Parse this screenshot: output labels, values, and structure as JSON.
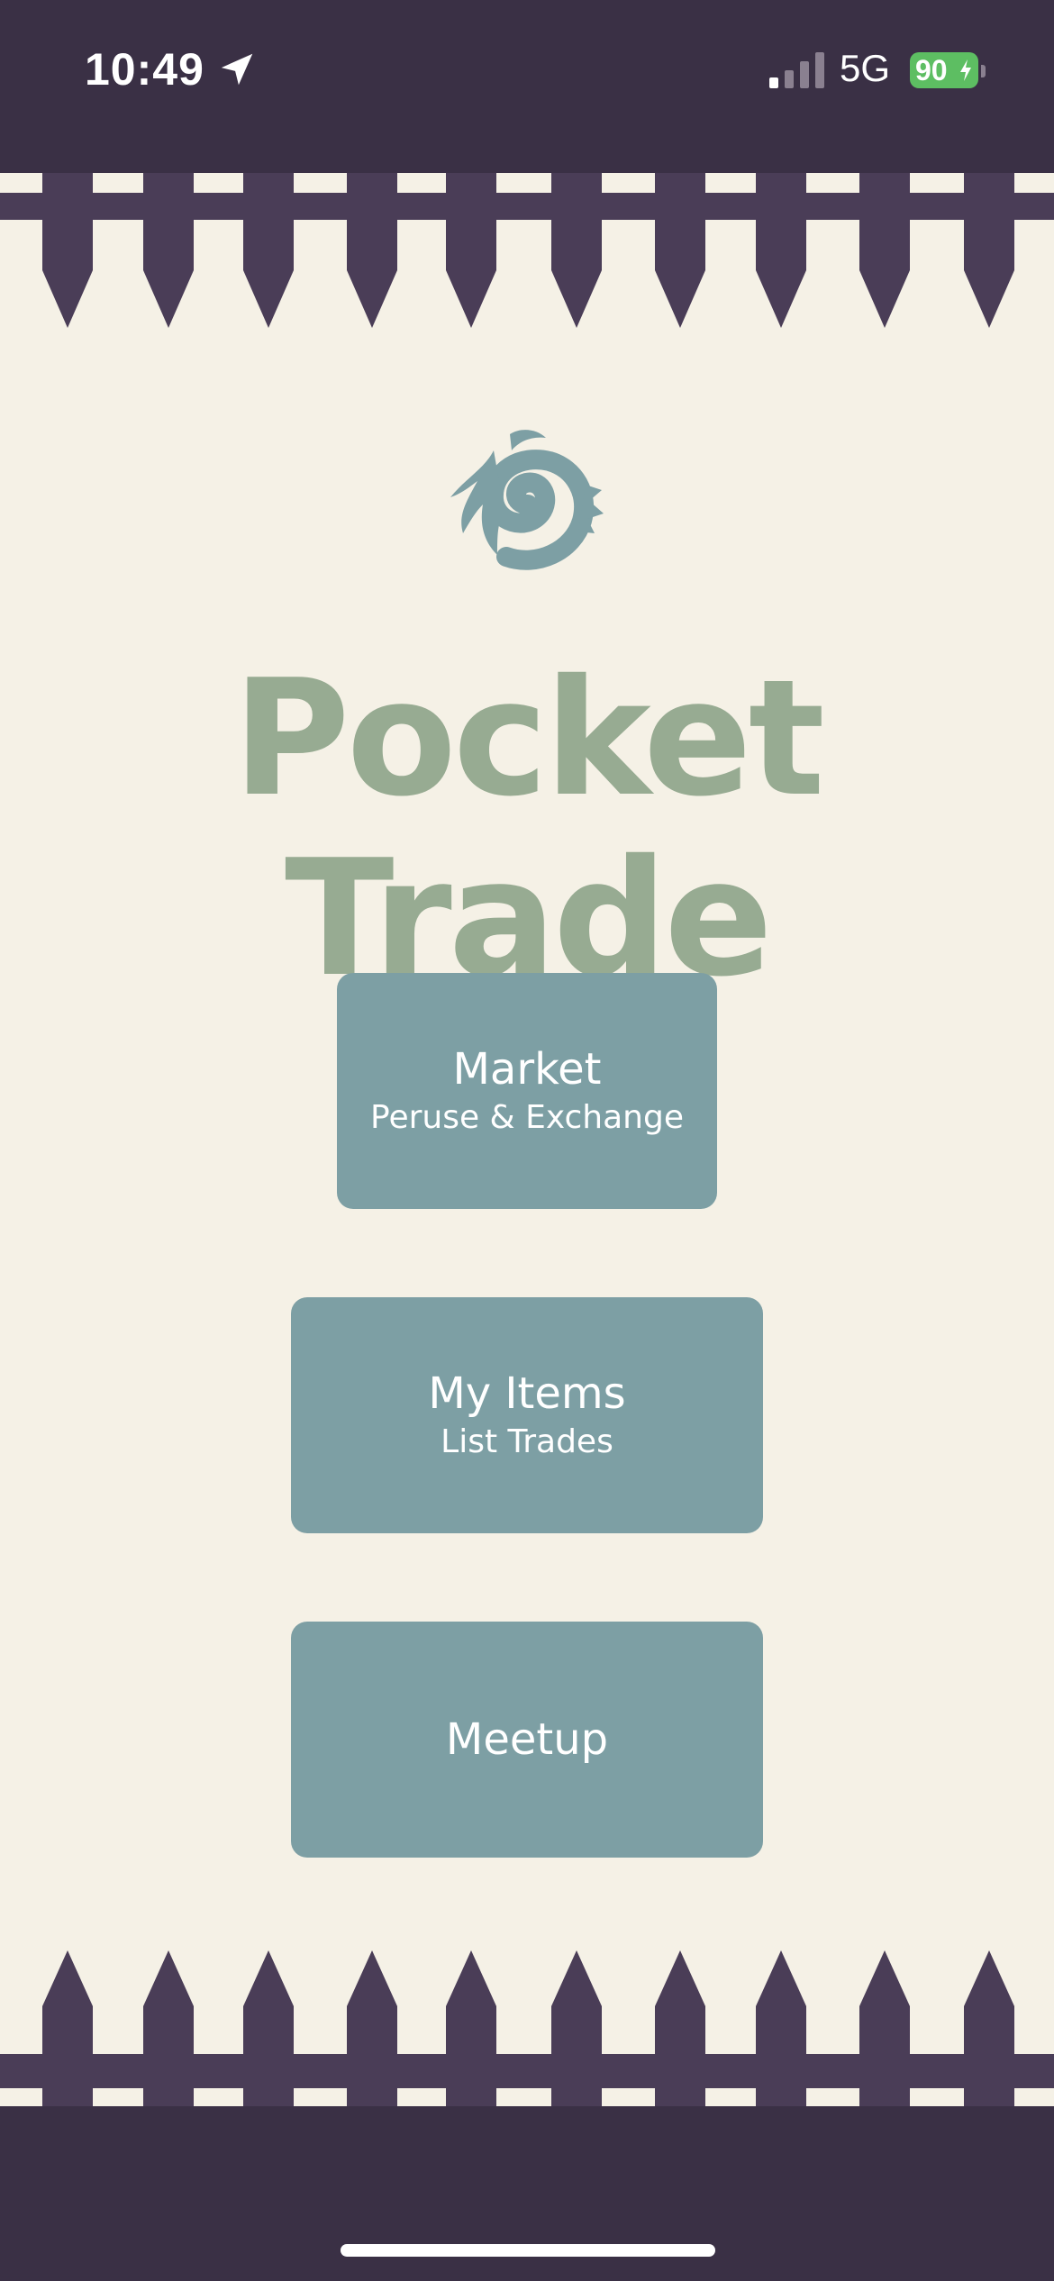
{
  "status_bar": {
    "time": "10:49",
    "network": "5G",
    "battery": "90"
  },
  "colors": {
    "fence": "#4a3d57",
    "bar": "#3a3045",
    "background": "#f5f1e6",
    "title": "#97ab92",
    "button": "#7d9fa4",
    "logo": "#7d9fa4"
  },
  "app": {
    "title": "Pocket Trade",
    "logo_icon": "swirl-logo-icon"
  },
  "menu": {
    "market": {
      "title": "Market",
      "subtitle": "Peruse & Exchange"
    },
    "my_items": {
      "title": "My Items",
      "subtitle": "List Trades"
    },
    "meetup": {
      "title": "Meetup"
    }
  }
}
